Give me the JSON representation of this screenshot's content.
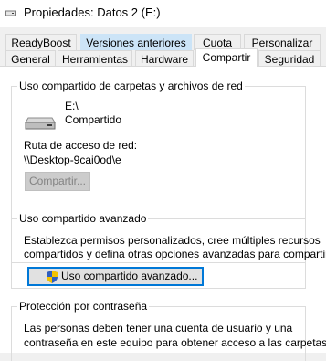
{
  "window": {
    "title": "Propiedades: Datos 2 (E:)"
  },
  "tabs": {
    "row_top": [
      {
        "label": "ReadyBoost"
      },
      {
        "label": "Versiones anteriores"
      },
      {
        "label": "Cuota"
      },
      {
        "label": "Personalizar"
      }
    ],
    "row_bottom": [
      {
        "label": "General"
      },
      {
        "label": "Herramientas"
      },
      {
        "label": "Hardware"
      },
      {
        "label": "Compartir"
      },
      {
        "label": "Seguridad"
      }
    ],
    "active": "Compartir"
  },
  "network_sharing": {
    "title": "Uso compartido de carpetas y archivos de red",
    "drive_label": "E:\\",
    "status": "Compartido",
    "path_label": "Ruta de acceso de red:",
    "path_value": "\\\\Desktop-9cai0od\\e",
    "share_button": "Compartir..."
  },
  "advanced_sharing": {
    "title": "Uso compartido avanzado",
    "description_line1": "Establezca permisos personalizados, cree múltiples recursos",
    "description_line2": "compartidos y defina otras opciones avanzadas para compartir.",
    "button": "Uso compartido avanzado..."
  },
  "password_protection": {
    "title": "Protección por contraseña",
    "description_line1": "Las personas deben tener una cuenta de usuario y una",
    "description_line2": "contraseña en este equipo para obtener acceso a las carpetas"
  },
  "colors": {
    "hover_tab": "#cce4f7",
    "primary_border": "#0078d7"
  }
}
